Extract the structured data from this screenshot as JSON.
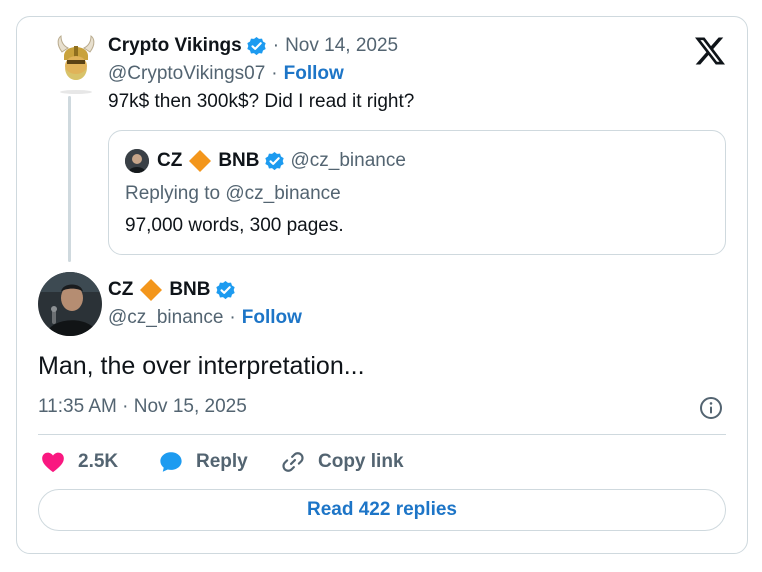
{
  "parent": {
    "name": "Crypto Vikings",
    "date": "Nov 14, 2025",
    "handle": "@CryptoVikings07",
    "follow_label": "Follow",
    "text": "97k$ then 300k$? Did I read it right?"
  },
  "quote": {
    "name_prefix": "CZ",
    "name_suffix": "BNB",
    "handle": "@cz_binance",
    "replying_to": "Replying to @cz_binance",
    "text": "97,000 words, 300 pages."
  },
  "main": {
    "name_prefix": "CZ",
    "name_suffix": "BNB",
    "handle": "@cz_binance",
    "follow_label": "Follow",
    "text": "Man, the over interpretation...",
    "timestamp": "11:35 AM · Nov 15, 2025"
  },
  "actions": {
    "like_count": "2.5K",
    "reply_label": "Reply",
    "copy_label": "Copy link"
  },
  "read_replies_label": "Read 422 replies",
  "icons": {
    "brand": "x-logo-icon",
    "verified": "verified-badge-icon",
    "diamond": "bnb-diamond-icon",
    "like": "heart-icon",
    "reply": "speech-bubble-icon",
    "copy": "link-icon",
    "info": "info-icon"
  },
  "colors": {
    "accent": "#1d75c7",
    "verified": "#1d9bf0",
    "like": "#f91880",
    "diamond": "#f3961c",
    "muted": "#536471",
    "border": "#cfd9de"
  }
}
